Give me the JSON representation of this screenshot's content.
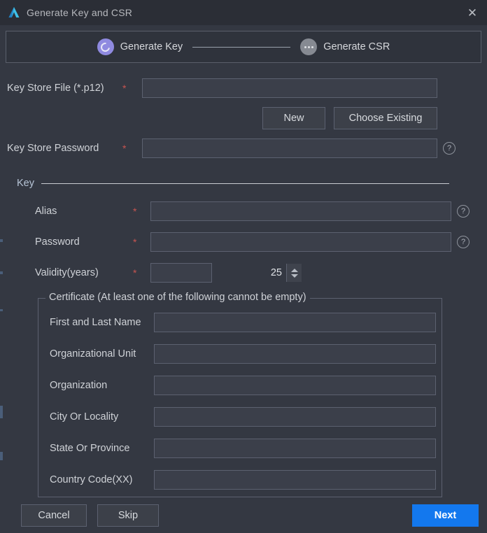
{
  "window": {
    "title": "Generate Key and CSR",
    "app_icon": "android-studio-icon",
    "close_label": "✕"
  },
  "stepper": {
    "steps": [
      {
        "label": "Generate Key",
        "state": "active",
        "icon": "ring-icon"
      },
      {
        "label": "Generate CSR",
        "state": "pending",
        "icon": "ellipsis-icon"
      }
    ]
  },
  "colors": {
    "accent_primary": "#1378ee",
    "step_active": "#8f8ae0",
    "step_pending": "#868a92",
    "required_asterisk": "#c75450",
    "window_bg": "#343842",
    "titlebar_bg": "#2b2e36",
    "field_bg": "#3b3f4a",
    "field_border": "#5c6170"
  },
  "keystore": {
    "file_label": "Key Store File (*.p12)",
    "file_required": "*",
    "file_value": "",
    "file_placeholder": "",
    "new_button": "New",
    "choose_existing_button": "Choose Existing",
    "password_label": "Key Store Password",
    "password_required": "*",
    "password_value": "",
    "password_placeholder": "",
    "help_icon": "?"
  },
  "key_section": {
    "title": "Key",
    "alias_label": "Alias",
    "alias_required": "*",
    "alias_value": "",
    "alias_help": "?",
    "password_label": "Password",
    "password_required": "*",
    "password_value": "",
    "password_help": "?",
    "validity_label": "Validity(years)",
    "validity_required": "*",
    "validity_value": "25"
  },
  "certificate": {
    "legend": "Certificate (At least one of the following cannot be empty)",
    "fields": [
      {
        "label": "First and Last Name",
        "value": ""
      },
      {
        "label": "Organizational Unit",
        "value": ""
      },
      {
        "label": "Organization",
        "value": ""
      },
      {
        "label": "City Or Locality",
        "value": ""
      },
      {
        "label": "State Or Province",
        "value": ""
      },
      {
        "label": "Country Code(XX)",
        "value": ""
      }
    ]
  },
  "footer": {
    "cancel_label": "Cancel",
    "skip_label": "Skip",
    "next_label": "Next"
  }
}
